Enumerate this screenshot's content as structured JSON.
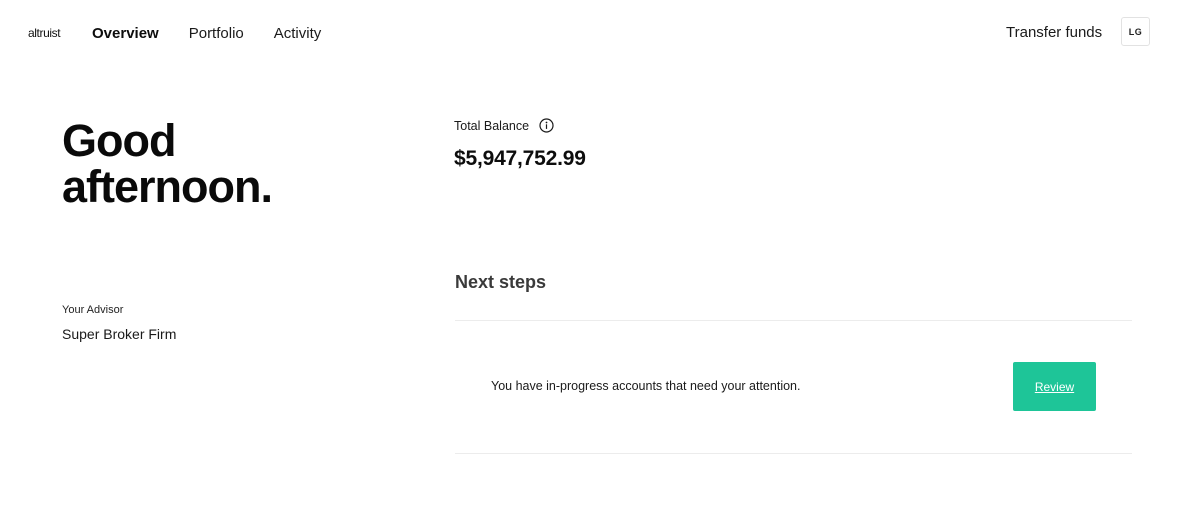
{
  "header": {
    "logo": "altruist",
    "nav": [
      {
        "label": "Overview",
        "active": true
      },
      {
        "label": "Portfolio",
        "active": false
      },
      {
        "label": "Activity",
        "active": false
      }
    ],
    "transfer_label": "Transfer funds",
    "avatar_initials": "LG"
  },
  "greeting": {
    "line1": "Good",
    "line2": "afternoon."
  },
  "advisor": {
    "label": "Your Advisor",
    "name": "Super Broker Firm"
  },
  "balance": {
    "label": "Total Balance",
    "info_icon": "info-circle-icon",
    "value": "$5,947,752.99"
  },
  "next_steps": {
    "title": "Next steps",
    "items": [
      {
        "text": "You have in-progress accounts that need your attention.",
        "action_label": "Review"
      }
    ]
  },
  "colors": {
    "accent": "#1ec598",
    "text": "#111111",
    "divider": "#ececec"
  }
}
